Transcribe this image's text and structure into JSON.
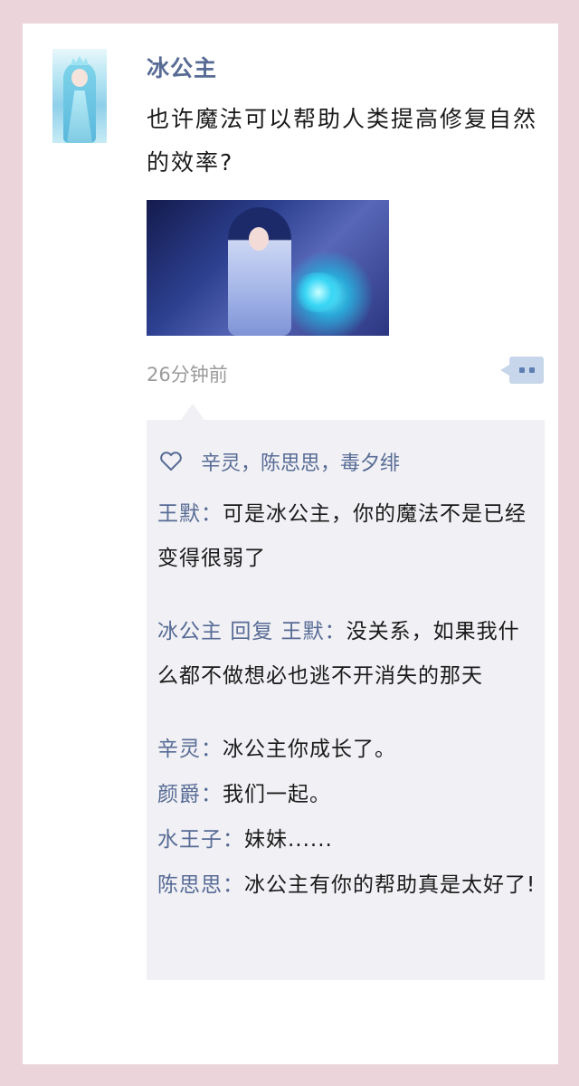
{
  "post": {
    "author": "冰公主",
    "text": "也许魔法可以帮助人类提高修复自然的效率?",
    "time": "26分钟前"
  },
  "likes": {
    "names": "辛灵，陈思思，毒夕绯"
  },
  "comments": [
    {
      "author": "王默",
      "sep": "：",
      "text": "可是冰公主，你的魔法不是已经变得很弱了"
    },
    {
      "author": "冰公主",
      "reply_word": "回复",
      "reply_to": "王默",
      "sep": "：",
      "text": "没关系，如果我什么都不做想必也逃不开消失的那天"
    },
    {
      "author": "辛灵",
      "sep": "：",
      "text": "冰公主你成长了。"
    },
    {
      "author": "颜爵",
      "sep": "：",
      "text": "我们一起。"
    },
    {
      "author": "水王子",
      "sep": "：",
      "text": "妹妹......"
    },
    {
      "author": "陈思思",
      "sep": "：",
      "text": "冰公主有你的帮助真是太好了!"
    }
  ],
  "icons": {
    "heart": "heart-icon",
    "comment": "comment-icon"
  },
  "colors": {
    "name_blue": "#576b95",
    "background_pink": "#ebd5da",
    "comment_bg": "#f1f1f5"
  }
}
